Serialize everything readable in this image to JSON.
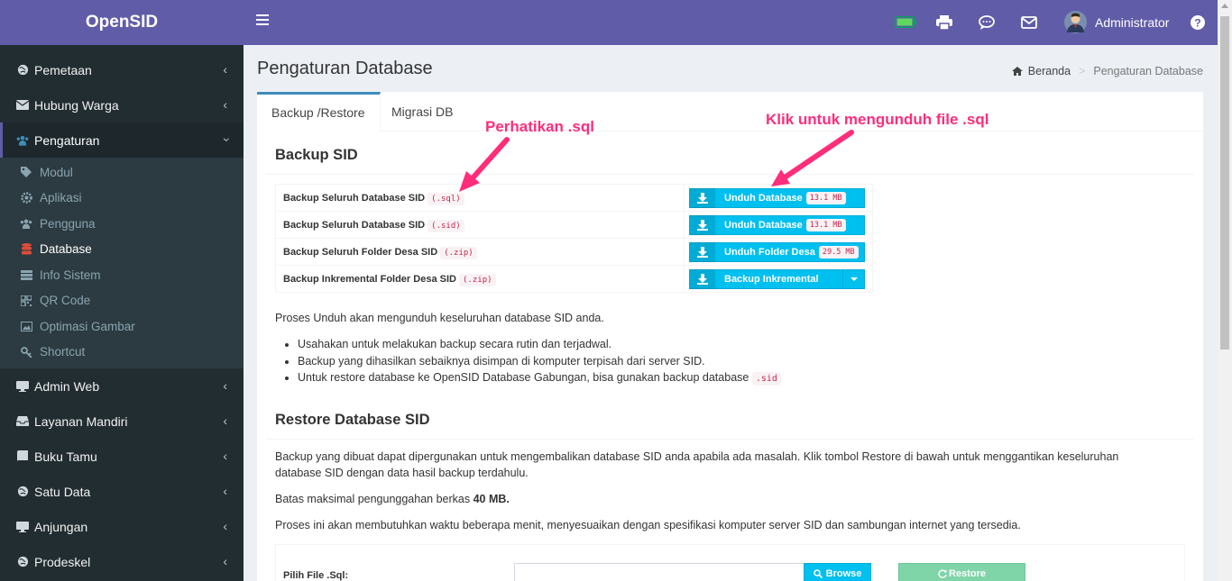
{
  "app": {
    "name": "OpenSID"
  },
  "colors": {
    "brand": "#605ca8",
    "sidebar": "#222d32",
    "info": "#00c0ef",
    "success": "#00a65a",
    "annotation": "#ff2d7a",
    "database_icon": "#dd4b39"
  },
  "sidebar": {
    "items": [
      {
        "label": "Pemetaan",
        "icon": "globe-icon"
      },
      {
        "label": "Hubung Warga",
        "icon": "envelope-icon"
      },
      {
        "label": "Pengaturan",
        "icon": "users-icon",
        "expanded": true
      }
    ],
    "sub_items": [
      {
        "label": "Modul",
        "icon": "tags-icon"
      },
      {
        "label": "Aplikasi",
        "icon": "cog-icon"
      },
      {
        "label": "Pengguna",
        "icon": "users-icon"
      },
      {
        "label": "Database",
        "icon": "database-icon",
        "active": true
      },
      {
        "label": "Info Sistem",
        "icon": "server-icon"
      },
      {
        "label": "QR Code",
        "icon": "qrcode-icon"
      },
      {
        "label": "Optimasi Gambar",
        "icon": "image-icon"
      },
      {
        "label": "Shortcut",
        "icon": "key-icon"
      }
    ],
    "items_after": [
      {
        "label": "Admin Web",
        "icon": "desktop-icon"
      },
      {
        "label": "Layanan Mandiri",
        "icon": "inbox-icon"
      },
      {
        "label": "Buku Tamu",
        "icon": "book-icon"
      },
      {
        "label": "Satu Data",
        "icon": "globe-icon"
      },
      {
        "label": "Anjungan",
        "icon": "desktop-icon"
      },
      {
        "label": "Prodeskel",
        "icon": "globe-icon"
      }
    ]
  },
  "header": {
    "user_name": "Administrator",
    "icons": [
      "battery-icon",
      "print-icon",
      "chat-icon",
      "mail-icon",
      "avatar",
      "help-icon"
    ]
  },
  "page": {
    "title": "Pengaturan Database",
    "breadcrumb": {
      "home": "Beranda",
      "current": "Pengaturan Database"
    }
  },
  "tabs": [
    {
      "label": "Backup /Restore",
      "active": true
    },
    {
      "label": "Migrasi DB",
      "active": false
    }
  ],
  "backup": {
    "title": "Backup SID",
    "rows": [
      {
        "label": "Backup Seluruh Database SID",
        "ext": "(.sql)",
        "button": "Unduh Database",
        "size": "13.1 MB"
      },
      {
        "label": "Backup Seluruh Database SID",
        "ext": "(.sid)",
        "button": "Unduh Database",
        "size": "13.1 MB"
      },
      {
        "label": "Backup Seluruh Folder Desa SID",
        "ext": "(.zip)",
        "button": "Unduh Folder Desa",
        "size": "29.5 MB"
      },
      {
        "label": "Backup Inkremental Folder Desa SID",
        "ext": "(.zip)",
        "button": "Backup Inkremental",
        "size": ""
      }
    ],
    "intro": "Proses Unduh akan mengunduh keseluruhan database SID anda.",
    "bullets": [
      "Usahakan untuk melakukan backup secara rutin dan terjadwal.",
      "Backup yang dihasilkan sebaiknya disimpan di komputer terpisah dari server SID.",
      "Untuk restore database ke OpenSID Database Gabungan, bisa gunakan backup database"
    ],
    "bullet_code": ".sid"
  },
  "annotations": {
    "left": "Perhatikan .sql",
    "right": "Klik untuk mengunduh file .sql"
  },
  "restore": {
    "title": "Restore Database SID",
    "desc_line1": "Backup yang dibuat dapat dipergunakan untuk mengembalikan database SID anda apabila ada masalah. Klik tombol Restore di bawah untuk menggantikan keseluruhan",
    "desc_line2": "database SID dengan data hasil backup terdahulu.",
    "limit_prefix": "Batas maksimal pengunggahan berkas",
    "limit_value": "40 MB.",
    "time_note": "Proses ini akan membutuhkan waktu beberapa menit, menyesuaikan dengan spesifikasi komputer server SID dan sambungan internet yang tersedia.",
    "file_label": "Pilih File .Sql:",
    "browse_label": "Browse",
    "restore_label": "Restore"
  }
}
